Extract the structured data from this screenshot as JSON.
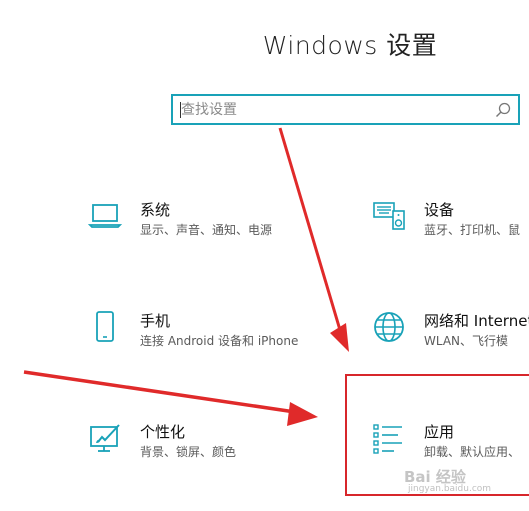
{
  "window": {
    "title": "Windows 设置"
  },
  "search": {
    "placeholder": "查找设置"
  },
  "tiles": [
    {
      "name": "系统",
      "desc": "显示、声音、通知、电源",
      "icon": "laptop-icon"
    },
    {
      "name": "设备",
      "desc": "蓝牙、打印机、鼠",
      "icon": "keyboard-device-icon"
    },
    {
      "name": "手机",
      "desc": "连接 Android 设备和 iPhone",
      "icon": "phone-icon"
    },
    {
      "name": "网络和 Internet",
      "desc": "WLAN、飞行模",
      "icon": "globe-icon"
    },
    {
      "name": "个性化",
      "desc": "背景、锁屏、颜色",
      "icon": "paint-icon"
    },
    {
      "name": "应用",
      "desc": "卸载、默认应用、",
      "icon": "apps-list-icon"
    }
  ],
  "colors": {
    "accent": "#19a2b8",
    "annotation": "#d7262b"
  },
  "watermark": {
    "text": "Bai 经验",
    "sub": "jingyan.baidu.com"
  }
}
